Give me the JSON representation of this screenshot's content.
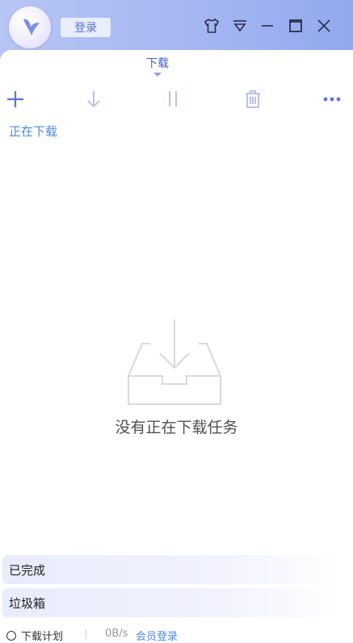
{
  "header": {
    "login_label": "登录"
  },
  "tab": {
    "label": "下载"
  },
  "toolbar": {
    "items": [
      "add-icon",
      "download-icon",
      "pause-icon",
      "trash-icon",
      "more-icon"
    ]
  },
  "sections": {
    "downloading": "正在下载",
    "completed": "已完成",
    "trash": "垃圾箱"
  },
  "empty_state": {
    "message": "没有正在下载任务"
  },
  "footer": {
    "plan": "下载计划",
    "speed": "0B/s",
    "member_login": "会员登录"
  },
  "colors": {
    "accent": "#5b74d6",
    "link": "#4f8ae0"
  }
}
